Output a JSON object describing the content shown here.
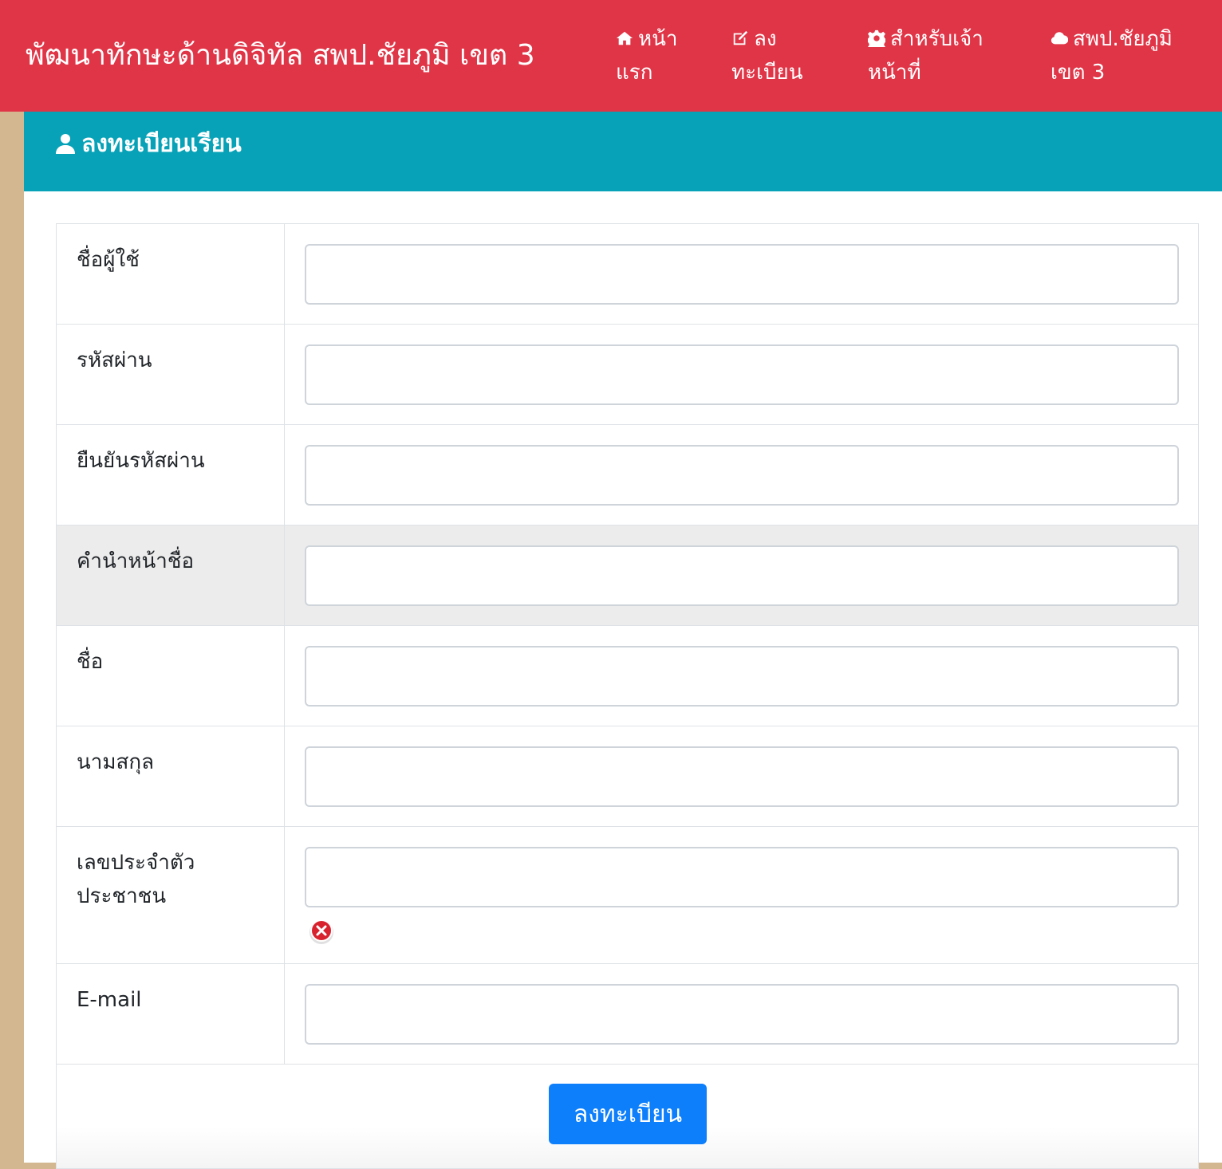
{
  "navbar": {
    "brand": "พัฒนาทักษะด้านดิจิทัล สพป.ชัยภูมิ เขต 3",
    "items": [
      {
        "line1": "หน้า",
        "line2": "แรก",
        "icon": "home-icon"
      },
      {
        "line1": "ลง",
        "line2": "ทะเบียน",
        "icon": "edit-icon"
      },
      {
        "line1": "สำหรับเจ้า",
        "line2": "หน้าที่",
        "icon": "gear-icon"
      },
      {
        "line1": "สพป.ชัยภูมิ",
        "line2": "เขต 3",
        "icon": "cloud-icon"
      }
    ]
  },
  "card": {
    "title": "ลงทะเบียนเรียน",
    "icon": "user-icon"
  },
  "form": {
    "fields": [
      {
        "label": "ชื่อผู้ใช้",
        "value": ""
      },
      {
        "label": "รหัสผ่าน",
        "value": ""
      },
      {
        "label": "ยืนยันรหัสผ่าน",
        "value": ""
      },
      {
        "label": "คำนำหน้าชื่อ",
        "value": ""
      },
      {
        "label": "ชื่อ",
        "value": ""
      },
      {
        "label": "นามสกุล",
        "value": ""
      },
      {
        "label_line1": "เลขประจำตัว",
        "label_line2": "ประชาชน",
        "value": "",
        "error_icon": "error-icon"
      },
      {
        "label": "E-mail",
        "value": ""
      }
    ],
    "submit_label": "ลงทะเบียน"
  },
  "colors": {
    "navbar": "#e03547",
    "card_header": "#07a2b7",
    "primary_button": "#0d7ffb",
    "sidebar": "#d3b790"
  }
}
